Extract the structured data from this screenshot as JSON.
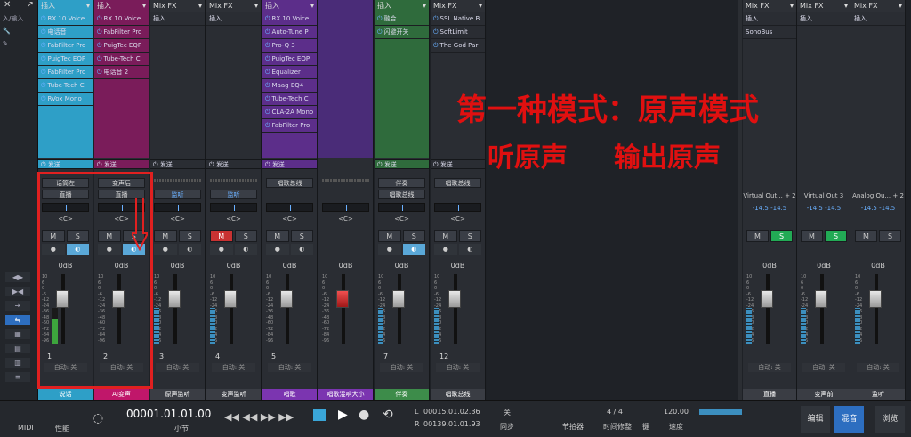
{
  "left": {
    "close": "✕",
    "pin": "↗",
    "rows": [
      "入/输入",
      "🔧",
      "✎"
    ]
  },
  "channels": [
    {
      "header": "插入",
      "color": "#2e9fc7",
      "inserts": [
        "RX 10 Voice",
        "电话音",
        "FabFilter Pro",
        "PuigTec EQP",
        "FabFilter Pro",
        "Tube-Tech C",
        "RVox Mono"
      ],
      "send": "发送",
      "input": "话筒左",
      "mode": "直播",
      "pan": "<C>",
      "db": "0dB",
      "num": "1",
      "name": "说话",
      "nameColor": "#2e9fc7",
      "auto": "自动: 关",
      "meter": "green",
      "mute": "M",
      "solo": "S"
    },
    {
      "header": "插入",
      "color": "#7a1c5a",
      "inserts": [
        "RX 10 Voice",
        "FabFilter Pro",
        "PuigTec EQP",
        "Tube-Tech C",
        "电话音 2"
      ],
      "send": "发送",
      "input": "变声后",
      "mode": "直播",
      "pan": "<C>",
      "db": "0dB",
      "num": "2",
      "name": "AI变声",
      "nameColor": "#c0176a",
      "auto": "自动: 关",
      "meter": "none",
      "mute": "M",
      "solo": "S"
    },
    {
      "header": "Mix FX",
      "color": "",
      "inserts": [
        "插入"
      ],
      "send": "发送",
      "input": "",
      "mode": "监听",
      "pan": "<C>",
      "db": "0dB",
      "num": "3",
      "name": "原声监听",
      "nameColor": "#3a3d44",
      "auto": "自动: 关",
      "meter": "blue",
      "mute": "M",
      "solo": "S"
    },
    {
      "header": "Mix FX",
      "color": "",
      "inserts": [
        "插入"
      ],
      "send": "发送",
      "input": "",
      "mode": "监听",
      "pan": "<C>",
      "db": "0dB",
      "num": "4",
      "name": "变声监听",
      "nameColor": "#3a3d44",
      "auto": "自动: 关",
      "meter": "blue",
      "mute": "M",
      "solo": "S",
      "muteOn": true
    },
    {
      "header": "插入",
      "color": "#5c2e8a",
      "inserts": [
        "RX 10 Voice",
        "Auto-Tune P",
        "Pro-Q 3",
        "PuigTec EQP",
        "Equalizer",
        "Maag EQ4",
        "Tube-Tech C",
        "CLA-2A Mono",
        "FabFilter Pro"
      ],
      "send": "发送",
      "input": "唱歌总线",
      "mode": "",
      "pan": "<C>",
      "db": "0dB",
      "num": "5",
      "name": "唱歌",
      "nameColor": "#7b35b0",
      "auto": "自动: 关",
      "meter": "none",
      "mute": "M",
      "solo": "S"
    },
    {
      "header": "",
      "color": "#4a2c78",
      "inserts": [],
      "send": "",
      "input": "",
      "mode": "",
      "pan": "<C>",
      "db": "0dB",
      "num": "",
      "name": "唱歌混响大小",
      "nameColor": "#7b35b0",
      "auto": "",
      "meter": "red",
      "mute": "",
      "solo": ""
    },
    {
      "header": "插入",
      "color": "#2f6b3c",
      "inserts": [
        "融合",
        "闪避开关"
      ],
      "send": "发送",
      "input": "伴奏",
      "mode": "唱歌总线",
      "pan": "<C>",
      "db": "0dB",
      "num": "7",
      "name": "伴奏",
      "nameColor": "#3d8c4a",
      "auto": "自动: 关",
      "meter": "blue",
      "mute": "M",
      "solo": "S",
      "soloMon": true
    },
    {
      "header": "Mix FX",
      "color": "",
      "inserts": [
        "SSL Native B",
        "SoftLimit",
        "The God Par"
      ],
      "send": "发送",
      "input": "唱歌总线",
      "mode": "",
      "pan": "<C>",
      "db": "0dB",
      "num": "12",
      "name": "唱歌总线",
      "nameColor": "#3a3d44",
      "auto": "自动: 关",
      "meter": "blue",
      "mute": "M",
      "solo": "S"
    }
  ],
  "outputs": [
    {
      "header": "Mix FX",
      "inserts": [
        "插入",
        "SonoBus"
      ],
      "out": "Virtual Out... + 2",
      "vals": [
        "-14.5",
        "-14.5"
      ],
      "db": "0dB",
      "name": "直播",
      "soloOn": true,
      "mute": "M",
      "solo": "S",
      "auto": "自动: 关"
    },
    {
      "header": "Mix FX",
      "inserts": [
        "插入"
      ],
      "out": "Virtual Out 3",
      "vals": [
        "-14.5",
        "-14.5"
      ],
      "db": "0dB",
      "name": "变声前",
      "soloOn": true,
      "mute": "M",
      "solo": "S",
      "auto": "自动: 关"
    },
    {
      "header": "Mix FX",
      "inserts": [
        "插入"
      ],
      "out": "Analog Ou... + 2",
      "vals": [
        "-14.5",
        "-14.5"
      ],
      "db": "0dB",
      "name": "监听",
      "soloOn": false,
      "mute": "M",
      "solo": "S",
      "auto": "自动: 关"
    }
  ],
  "overlay": {
    "line1": "第一种模式：原声模式",
    "line2a": "听原声",
    "line2b": "输出原声"
  },
  "transport": {
    "midi": "MIDI",
    "perf": "性能",
    "time": "00001.01.01.00",
    "timeUnit": "小节",
    "L": "00015.01.02.36",
    "R": "00139.01.01.93",
    "sync_label": "关",
    "sync": "同步",
    "metronome": "节拍器",
    "sig": "4 / 4",
    "sigLabel": "时间修整",
    "key": "键",
    "tempo": "120.00",
    "tempoLabel": "速度",
    "edit": "编辑",
    "mix": "混音",
    "browse": "浏览"
  }
}
